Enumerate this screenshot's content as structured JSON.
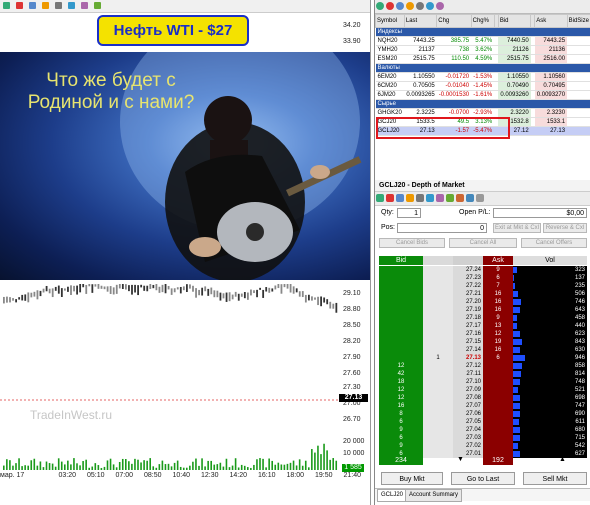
{
  "chart": {
    "price_ticks": [
      "34.20",
      "33.90",
      "29.10",
      "28.80",
      "28.50",
      "28.20",
      "27.90",
      "27.60",
      "27.30",
      "27.00",
      "26.70"
    ],
    "price_marker": "27.13",
    "volume_ticks": [
      "20 000",
      "10 000"
    ],
    "volume_marker": "1 585",
    "time_ticks": [
      "мар. 17",
      "03:20",
      "05:10",
      "07:00",
      "08:50",
      "10:40",
      "12:30",
      "14:20",
      "16:10",
      "18:00",
      "19:50",
      "21:40"
    ],
    "banner": "Нефть WTI - $27",
    "photo_caption": "Что же будет с Родиной и с нами?",
    "watermark": "TradeInWest.ru",
    "toolbar_icons": [
      "cursor-icon",
      "cross-icon",
      "zoom-icon",
      "bar-chart-icon",
      "line-icon",
      "text-icon",
      "arrow-icon",
      "color-icon"
    ]
  },
  "quotes": {
    "toolbar_icons": [
      "add-icon",
      "delete-icon",
      "green-icon",
      "orange-icon",
      "properties-icon",
      "link-icon",
      "grid-icon"
    ],
    "columns": [
      "Symbol",
      "Last",
      "Chg",
      "Chg%",
      "",
      "Bid",
      "",
      "Ask",
      "BidSize"
    ],
    "groups": [
      {
        "name": "Индексы",
        "rows": [
          {
            "symbol": "NQH20",
            "last": "7443.25",
            "chg": "385.75",
            "pct": "5.47%",
            "bid": "7440.50",
            "ask": "7443.25",
            "chg_color": "pos"
          },
          {
            "symbol": "YMH20",
            "last": "21137",
            "chg": "738",
            "pct": "3.62%",
            "bid": "21126",
            "ask": "21136",
            "chg_color": "pos"
          },
          {
            "symbol": "ESM20",
            "last": "2515.75",
            "chg": "110.50",
            "pct": "4.59%",
            "bid": "2515.75",
            "ask": "2516.00",
            "chg_color": "pos"
          }
        ]
      },
      {
        "name": "Валюты",
        "rows": [
          {
            "symbol": "6EM20",
            "last": "1.10550",
            "chg": "-0.01720",
            "pct": "-1.53%",
            "bid": "1.10550",
            "ask": "1.10560",
            "chg_color": "neg"
          },
          {
            "symbol": "6CM20",
            "last": "0.70505",
            "chg": "-0.01040",
            "pct": "-1.45%",
            "bid": "0.70490",
            "ask": "0.70495",
            "chg_color": "neg"
          },
          {
            "symbol": "6JM20",
            "last": "0.0093265",
            "chg": "-0.0001530",
            "pct": "-1.61%",
            "bid": "0.0093260",
            "ask": "0.0093270",
            "chg_color": "neg"
          }
        ]
      },
      {
        "name": "Сырье",
        "rows": [
          {
            "symbol": "GHGK20",
            "last": "2.3225",
            "chg": "-0.0700",
            "pct": "-2.93%",
            "bid": "2.3220",
            "ask": "2.3230",
            "chg_color": "neg"
          },
          {
            "symbol": "GCJ20",
            "last": "1533.5",
            "chg": "49.5",
            "pct": "3.13%",
            "bid": "1532.8",
            "ask": "1533.1",
            "chg_color": "pos"
          },
          {
            "symbol": "GCLJ20",
            "last": "27.13",
            "chg": "-1.57",
            "pct": "-5.47%",
            "bid": "27.12",
            "ask": "27.13",
            "chg_color": "neg",
            "selected": true
          }
        ]
      }
    ]
  },
  "dom": {
    "title": "GCLJ20 - Depth of Market",
    "toolbar_icons": [
      "pin-icon",
      "options-icon",
      "link-icon",
      "chart-icon",
      "ruler-icon",
      "lock-icon",
      "refresh-icon",
      "settings-icon",
      "help-icon",
      "list-icon",
      "flag-icon"
    ],
    "qty_label": "Qty:",
    "qty_value": "1",
    "open_pl_label": "Open P/L:",
    "open_pl_value": "$0,00",
    "pos_label": "Pos:",
    "pos_value": "0",
    "btn_exit_mkt": "Exit at Mkt & Cxl",
    "btn_reverse": "Reverse & Cxl",
    "btn_cancel_bids": "Cancel Bids",
    "btn_cancel_all": "Cancel All",
    "btn_cancel_offers": "Cancel Offers",
    "col_bid": "Bid",
    "col_ask": "Ask",
    "col_vol": "Vol",
    "ladder": [
      {
        "price": "27.24",
        "bid": "",
        "ask": "9",
        "vol": "323",
        "vf": 0.05
      },
      {
        "price": "27.23",
        "bid": "",
        "ask": "6",
        "vol": "137",
        "vf": 0.02
      },
      {
        "price": "27.22",
        "bid": "",
        "ask": "7",
        "vol": "235",
        "vf": 0.03
      },
      {
        "price": "27.21",
        "bid": "",
        "ask": "16",
        "vol": "506",
        "vf": 0.07
      },
      {
        "price": "27.20",
        "bid": "",
        "ask": "16",
        "vol": "746",
        "vf": 0.11
      },
      {
        "price": "27.19",
        "bid": "",
        "ask": "16",
        "vol": "643",
        "vf": 0.09
      },
      {
        "price": "27.18",
        "bid": "",
        "ask": "9",
        "vol": "458",
        "vf": 0.06
      },
      {
        "price": "27.17",
        "bid": "",
        "ask": "13",
        "vol": "440",
        "vf": 0.06
      },
      {
        "price": "27.16",
        "bid": "",
        "ask": "12",
        "vol": "623",
        "vf": 0.09
      },
      {
        "price": "27.15",
        "bid": "",
        "ask": "19",
        "vol": "843",
        "vf": 0.12
      },
      {
        "price": "27.14",
        "bid": "",
        "ask": "16",
        "vol": "630",
        "vf": 0.09
      },
      {
        "price": "27.13",
        "bid": "",
        "ask": "6",
        "vol": "946",
        "vf": 0.16,
        "last": true
      },
      {
        "price": "27.12",
        "bid": "12",
        "ask": "",
        "vol": "858",
        "vf": 0.12
      },
      {
        "price": "27.11",
        "bid": "42",
        "ask": "",
        "vol": "814",
        "vf": 0.11
      },
      {
        "price": "27.10",
        "bid": "18",
        "ask": "",
        "vol": "748",
        "vf": 0.1
      },
      {
        "price": "27.09",
        "bid": "12",
        "ask": "",
        "vol": "521",
        "vf": 0.07
      },
      {
        "price": "27.08",
        "bid": "12",
        "ask": "",
        "vol": "698",
        "vf": 0.1
      },
      {
        "price": "27.07",
        "bid": "16",
        "ask": "",
        "vol": "747",
        "vf": 0.1
      },
      {
        "price": "27.06",
        "bid": "8",
        "ask": "",
        "vol": "690",
        "vf": 0.09
      },
      {
        "price": "27.05",
        "bid": "6",
        "ask": "",
        "vol": "611",
        "vf": 0.08
      },
      {
        "price": "27.04",
        "bid": "9",
        "ask": "",
        "vol": "680",
        "vf": 0.09
      },
      {
        "price": "27.03",
        "bid": "6",
        "ask": "",
        "vol": "715",
        "vf": 0.1
      },
      {
        "price": "27.02",
        "bid": "9",
        "ask": "",
        "vol": "542",
        "vf": 0.07
      },
      {
        "price": "27.01",
        "bid": "6",
        "ask": "",
        "vol": "627",
        "vf": 0.09
      }
    ],
    "working_qty": "1",
    "bid_total": "234",
    "ask_total": "192",
    "btn_buy": "Buy Mkt",
    "btn_goto": "Go to Last",
    "btn_sell": "Sell Mkt",
    "tabs": [
      "GCLJ20",
      "Account Summary"
    ]
  }
}
